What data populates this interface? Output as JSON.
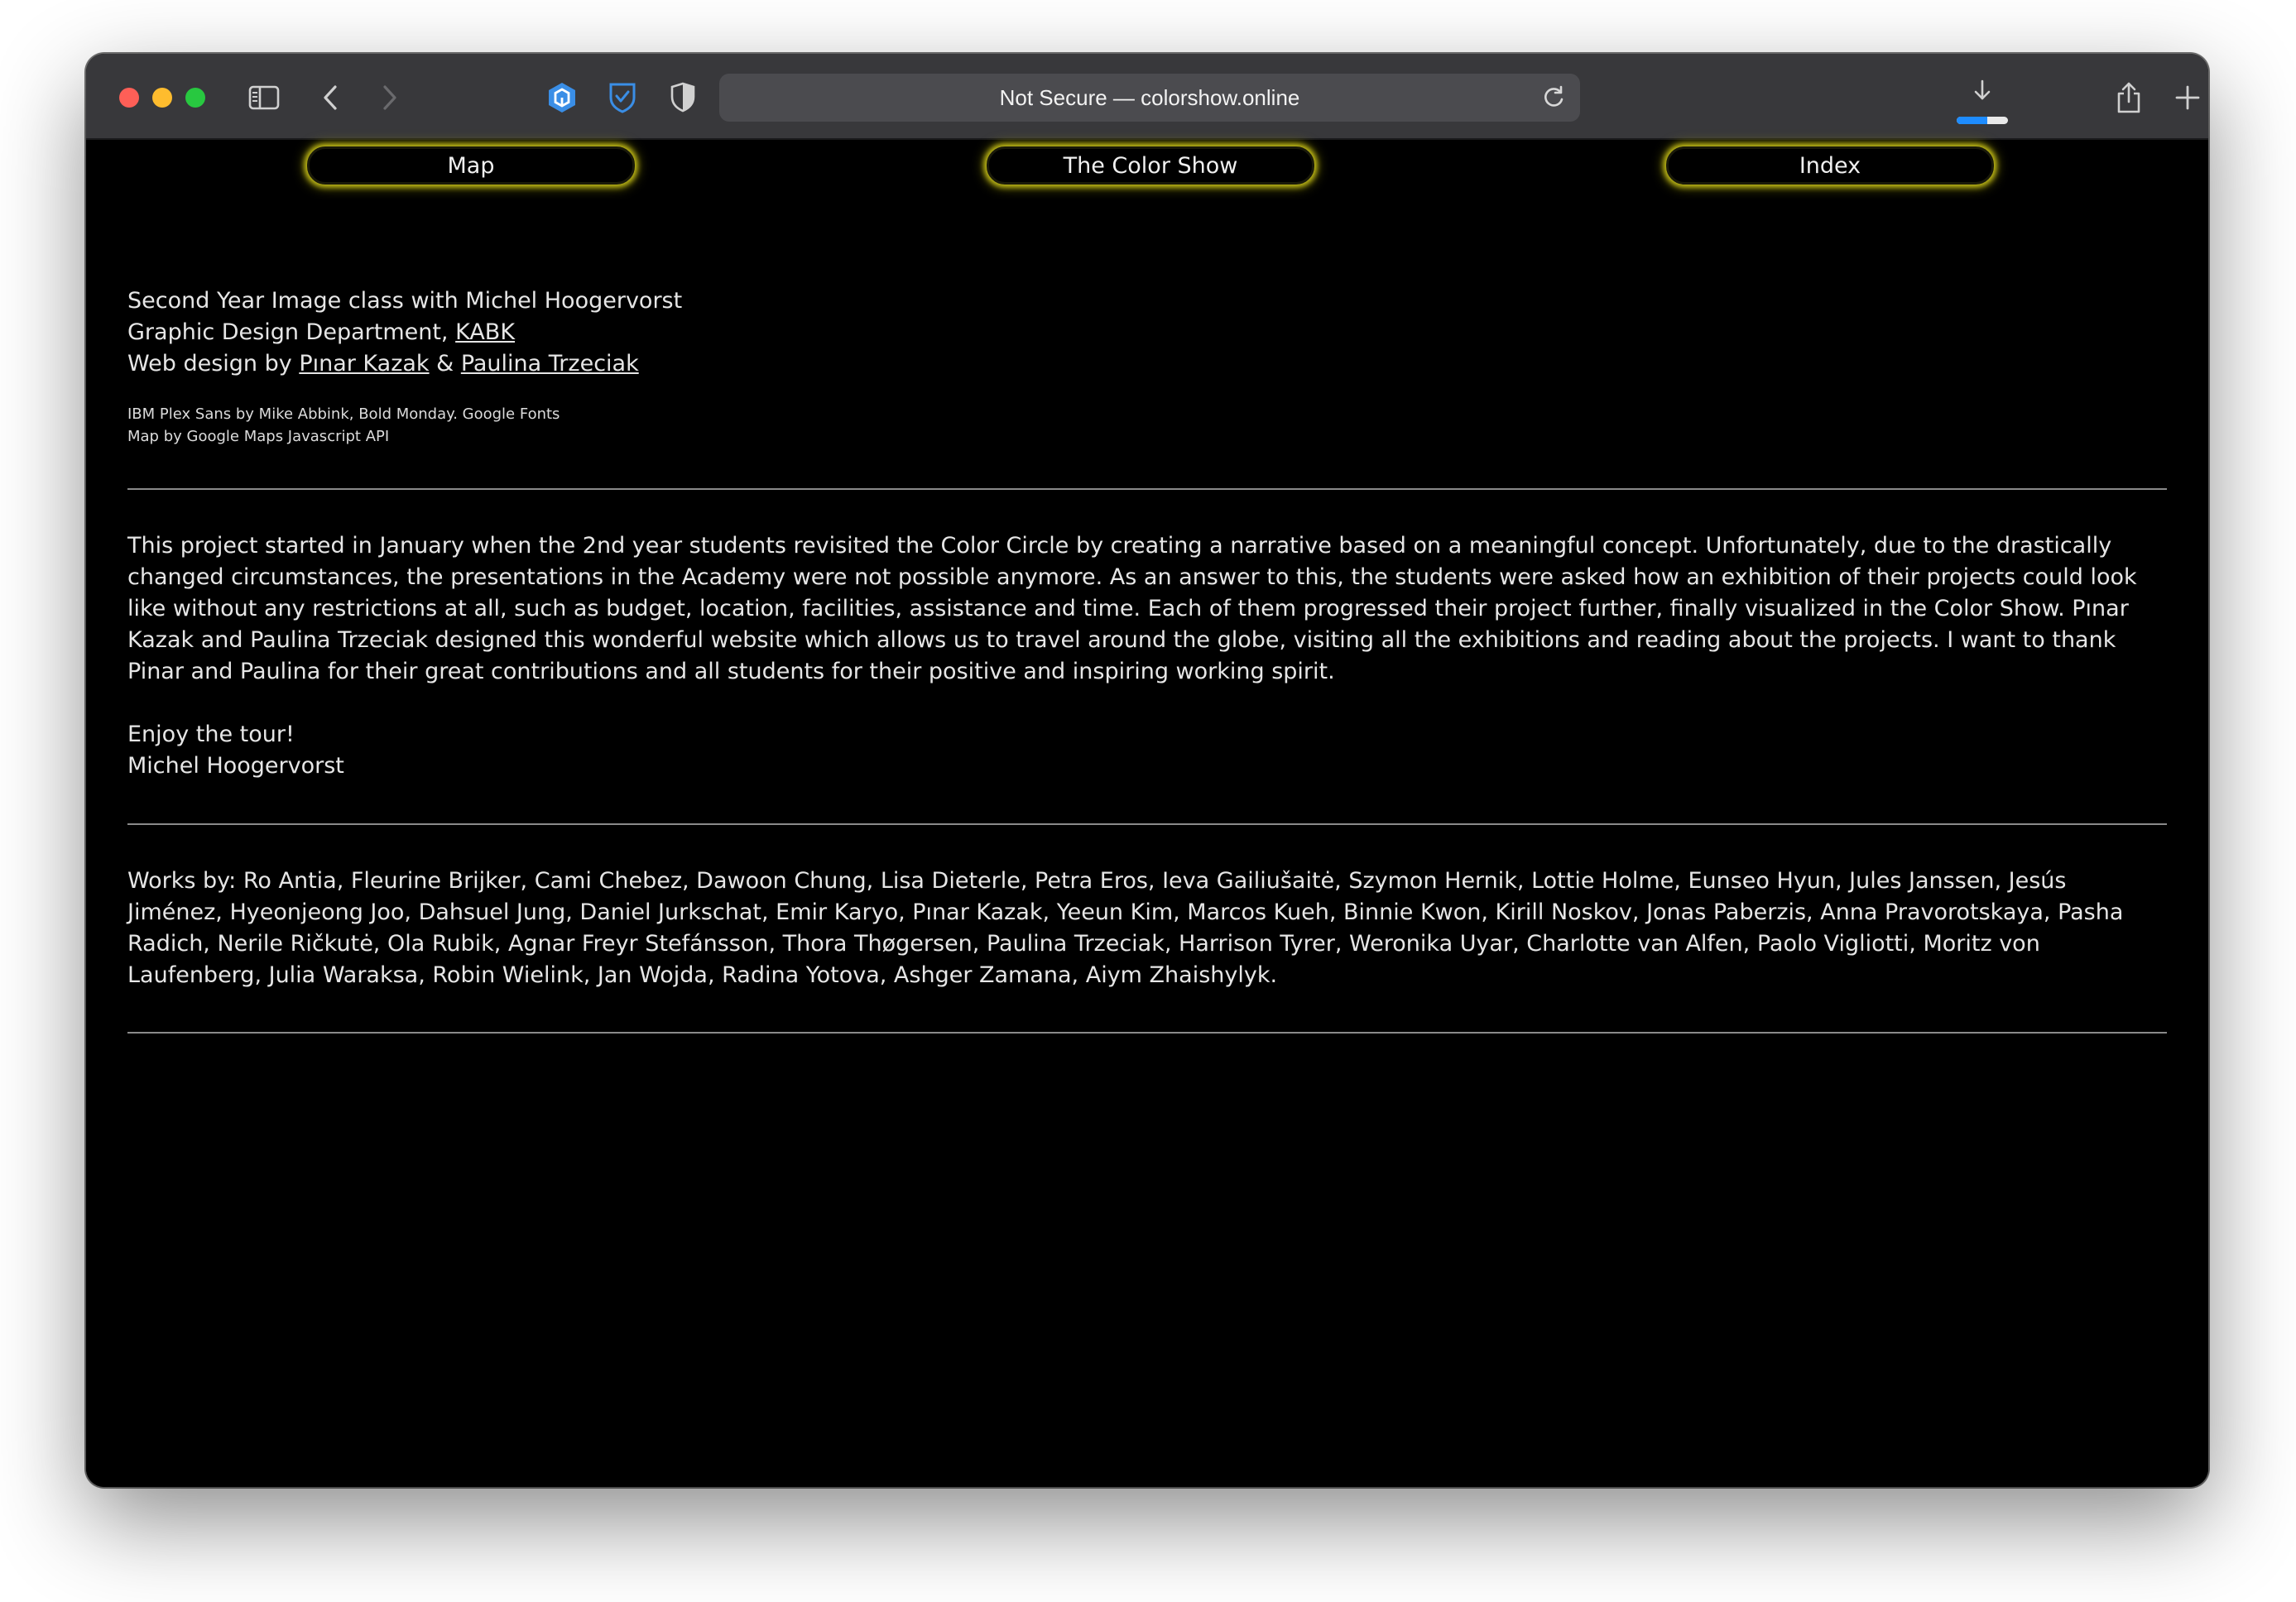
{
  "browser": {
    "url_display": "Not Secure — colorshow.online",
    "download_progress": 0.6,
    "colors": {
      "toolbar": "#38383b",
      "urlbar": "#4b4b4f",
      "accent": "#1e8cff",
      "extension_blue": "#3a8ee6"
    },
    "icons": [
      "sidebar-icon",
      "back-icon",
      "forward-icon",
      "extension-hexagon-icon",
      "bitwarden-shield-icon",
      "privacy-shield-icon",
      "reload-icon",
      "download-icon",
      "share-icon",
      "new-tab-icon",
      "tab-overview-icon"
    ]
  },
  "nav": {
    "map": "Map",
    "color_show": "The Color Show",
    "index": "Index",
    "glow_color": "#c9c219"
  },
  "credits": {
    "line1": "Second Year Image class with Michel Hoogervorst",
    "line2_prefix": "Graphic Design Department, ",
    "line2_link": "KABK",
    "line3_prefix": "Web design by ",
    "designer1": "Pınar Kazak",
    "amp": " & ",
    "designer2": "Paulina Trzeciak",
    "font_credit": "IBM Plex Sans by Mike Abbink, Bold Monday. Google Fonts",
    "map_credit": "Map by Google Maps Javascript API"
  },
  "intro": {
    "paragraph": "This project started in January when the 2nd year students revisited the Color Circle by creating a narrative based on a meaningful concept. Unfortunately, due to the drastically changed circumstances, the presentations in the Academy were not possible anymore. As an answer to this, the students were asked how an exhibition of their projects could look like without any restrictions at all, such as budget, location, facilities, assistance and time. Each of them progressed their project further, finally visualized in the Color Show. Pınar Kazak and Paulina Trzeciak designed this wonderful website which allows us to travel around the globe, visiting all the exhibitions and reading about the projects. I want to thank Pinar and Paulina for their great contributions and all students for their positive and inspiring working spirit.",
    "enjoy": "Enjoy the tour!",
    "signature": "Michel Hoogervorst"
  },
  "works": {
    "text": "Works by: Ro Antia, Fleurine Brijker, Cami Chebez, Dawoon Chung, Lisa Dieterle, Petra Eros, Ieva Gailiušaitė, Szymon Hernik, Lottie Holme, Eunseo Hyun, Jules Janssen, Jesús Jiménez, Hyeonjeong Joo, Dahsuel Jung, Daniel Jurkschat, Emir Karyo, Pınar Kazak, Yeeun Kim, Marcos Kueh, Binnie Kwon, Kirill Noskov, Jonas Paberzis, Anna Pravorotskaya, Pasha Radich, Nerile Ričkutė, Ola Rubik, Agnar Freyr Stefánsson, Thora Thøgersen, Paulina Trzeciak, Harrison Tyrer, Weronika Uyar, Charlotte van Alfen, Paolo Vigliotti, Moritz von Laufenberg, Julia Waraksa, Robin Wielink, Jan Wojda, Radina Yotova, Ashger Zamana, Aiym Zhaishylyk."
  }
}
